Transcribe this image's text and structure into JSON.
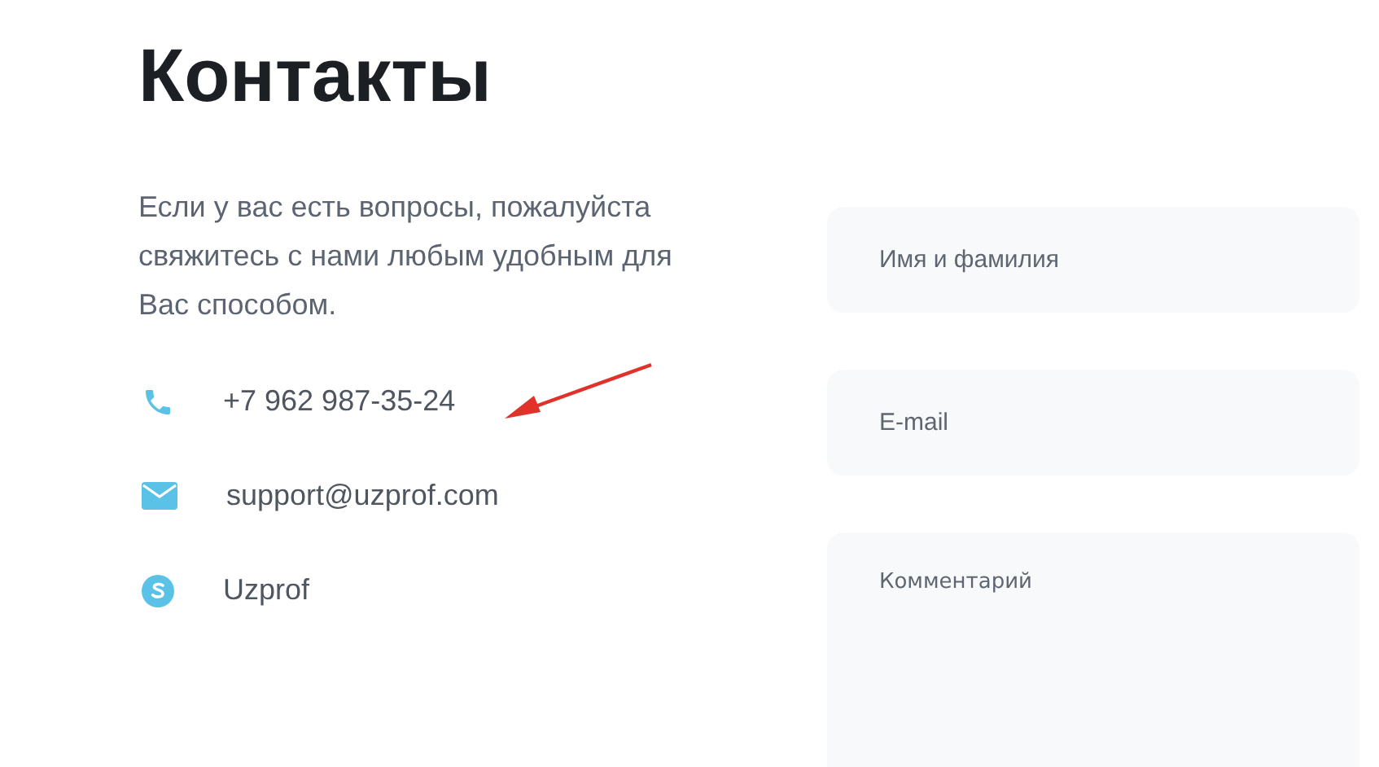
{
  "heading": "Контакты",
  "intro": "Если у вас есть вопросы, пожалуйста свяжитесь с нами любым удобным для Вас способом.",
  "contacts": [
    {
      "kind": "phone",
      "text": "+7 962 987-35-24"
    },
    {
      "kind": "email",
      "text": "support@uzprof.com"
    },
    {
      "kind": "skype",
      "text": "Uzprof"
    }
  ],
  "form": {
    "fields": [
      {
        "kind": "input",
        "placeholder": "Имя и фамилия"
      },
      {
        "kind": "input",
        "placeholder": "E-mail"
      },
      {
        "kind": "textarea",
        "placeholder": "Комментарий"
      }
    ]
  }
}
